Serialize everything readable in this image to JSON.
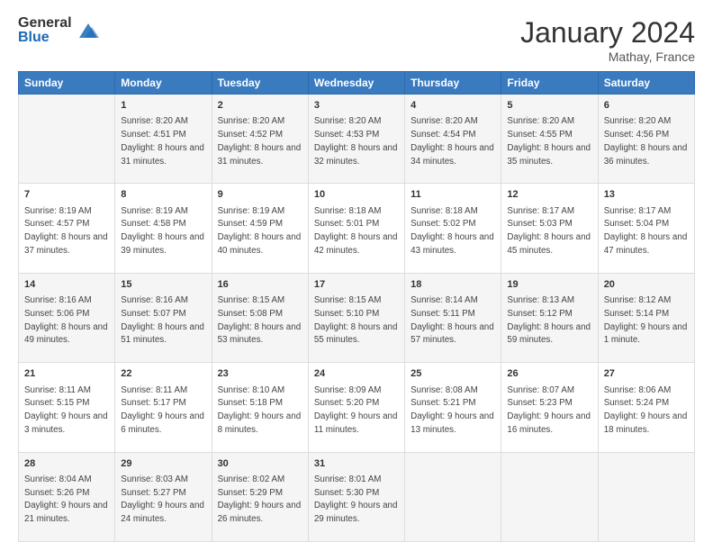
{
  "logo": {
    "general": "General",
    "blue": "Blue"
  },
  "title": "January 2024",
  "location": "Mathay, France",
  "days_of_week": [
    "Sunday",
    "Monday",
    "Tuesday",
    "Wednesday",
    "Thursday",
    "Friday",
    "Saturday"
  ],
  "weeks": [
    [
      {
        "num": "",
        "sunrise": "",
        "sunset": "",
        "daylight": ""
      },
      {
        "num": "1",
        "sunrise": "Sunrise: 8:20 AM",
        "sunset": "Sunset: 4:51 PM",
        "daylight": "Daylight: 8 hours and 31 minutes."
      },
      {
        "num": "2",
        "sunrise": "Sunrise: 8:20 AM",
        "sunset": "Sunset: 4:52 PM",
        "daylight": "Daylight: 8 hours and 31 minutes."
      },
      {
        "num": "3",
        "sunrise": "Sunrise: 8:20 AM",
        "sunset": "Sunset: 4:53 PM",
        "daylight": "Daylight: 8 hours and 32 minutes."
      },
      {
        "num": "4",
        "sunrise": "Sunrise: 8:20 AM",
        "sunset": "Sunset: 4:54 PM",
        "daylight": "Daylight: 8 hours and 34 minutes."
      },
      {
        "num": "5",
        "sunrise": "Sunrise: 8:20 AM",
        "sunset": "Sunset: 4:55 PM",
        "daylight": "Daylight: 8 hours and 35 minutes."
      },
      {
        "num": "6",
        "sunrise": "Sunrise: 8:20 AM",
        "sunset": "Sunset: 4:56 PM",
        "daylight": "Daylight: 8 hours and 36 minutes."
      }
    ],
    [
      {
        "num": "7",
        "sunrise": "Sunrise: 8:19 AM",
        "sunset": "Sunset: 4:57 PM",
        "daylight": "Daylight: 8 hours and 37 minutes."
      },
      {
        "num": "8",
        "sunrise": "Sunrise: 8:19 AM",
        "sunset": "Sunset: 4:58 PM",
        "daylight": "Daylight: 8 hours and 39 minutes."
      },
      {
        "num": "9",
        "sunrise": "Sunrise: 8:19 AM",
        "sunset": "Sunset: 4:59 PM",
        "daylight": "Daylight: 8 hours and 40 minutes."
      },
      {
        "num": "10",
        "sunrise": "Sunrise: 8:18 AM",
        "sunset": "Sunset: 5:01 PM",
        "daylight": "Daylight: 8 hours and 42 minutes."
      },
      {
        "num": "11",
        "sunrise": "Sunrise: 8:18 AM",
        "sunset": "Sunset: 5:02 PM",
        "daylight": "Daylight: 8 hours and 43 minutes."
      },
      {
        "num": "12",
        "sunrise": "Sunrise: 8:17 AM",
        "sunset": "Sunset: 5:03 PM",
        "daylight": "Daylight: 8 hours and 45 minutes."
      },
      {
        "num": "13",
        "sunrise": "Sunrise: 8:17 AM",
        "sunset": "Sunset: 5:04 PM",
        "daylight": "Daylight: 8 hours and 47 minutes."
      }
    ],
    [
      {
        "num": "14",
        "sunrise": "Sunrise: 8:16 AM",
        "sunset": "Sunset: 5:06 PM",
        "daylight": "Daylight: 8 hours and 49 minutes."
      },
      {
        "num": "15",
        "sunrise": "Sunrise: 8:16 AM",
        "sunset": "Sunset: 5:07 PM",
        "daylight": "Daylight: 8 hours and 51 minutes."
      },
      {
        "num": "16",
        "sunrise": "Sunrise: 8:15 AM",
        "sunset": "Sunset: 5:08 PM",
        "daylight": "Daylight: 8 hours and 53 minutes."
      },
      {
        "num": "17",
        "sunrise": "Sunrise: 8:15 AM",
        "sunset": "Sunset: 5:10 PM",
        "daylight": "Daylight: 8 hours and 55 minutes."
      },
      {
        "num": "18",
        "sunrise": "Sunrise: 8:14 AM",
        "sunset": "Sunset: 5:11 PM",
        "daylight": "Daylight: 8 hours and 57 minutes."
      },
      {
        "num": "19",
        "sunrise": "Sunrise: 8:13 AM",
        "sunset": "Sunset: 5:12 PM",
        "daylight": "Daylight: 8 hours and 59 minutes."
      },
      {
        "num": "20",
        "sunrise": "Sunrise: 8:12 AM",
        "sunset": "Sunset: 5:14 PM",
        "daylight": "Daylight: 9 hours and 1 minute."
      }
    ],
    [
      {
        "num": "21",
        "sunrise": "Sunrise: 8:11 AM",
        "sunset": "Sunset: 5:15 PM",
        "daylight": "Daylight: 9 hours and 3 minutes."
      },
      {
        "num": "22",
        "sunrise": "Sunrise: 8:11 AM",
        "sunset": "Sunset: 5:17 PM",
        "daylight": "Daylight: 9 hours and 6 minutes."
      },
      {
        "num": "23",
        "sunrise": "Sunrise: 8:10 AM",
        "sunset": "Sunset: 5:18 PM",
        "daylight": "Daylight: 9 hours and 8 minutes."
      },
      {
        "num": "24",
        "sunrise": "Sunrise: 8:09 AM",
        "sunset": "Sunset: 5:20 PM",
        "daylight": "Daylight: 9 hours and 11 minutes."
      },
      {
        "num": "25",
        "sunrise": "Sunrise: 8:08 AM",
        "sunset": "Sunset: 5:21 PM",
        "daylight": "Daylight: 9 hours and 13 minutes."
      },
      {
        "num": "26",
        "sunrise": "Sunrise: 8:07 AM",
        "sunset": "Sunset: 5:23 PM",
        "daylight": "Daylight: 9 hours and 16 minutes."
      },
      {
        "num": "27",
        "sunrise": "Sunrise: 8:06 AM",
        "sunset": "Sunset: 5:24 PM",
        "daylight": "Daylight: 9 hours and 18 minutes."
      }
    ],
    [
      {
        "num": "28",
        "sunrise": "Sunrise: 8:04 AM",
        "sunset": "Sunset: 5:26 PM",
        "daylight": "Daylight: 9 hours and 21 minutes."
      },
      {
        "num": "29",
        "sunrise": "Sunrise: 8:03 AM",
        "sunset": "Sunset: 5:27 PM",
        "daylight": "Daylight: 9 hours and 24 minutes."
      },
      {
        "num": "30",
        "sunrise": "Sunrise: 8:02 AM",
        "sunset": "Sunset: 5:29 PM",
        "daylight": "Daylight: 9 hours and 26 minutes."
      },
      {
        "num": "31",
        "sunrise": "Sunrise: 8:01 AM",
        "sunset": "Sunset: 5:30 PM",
        "daylight": "Daylight: 9 hours and 29 minutes."
      },
      {
        "num": "",
        "sunrise": "",
        "sunset": "",
        "daylight": ""
      },
      {
        "num": "",
        "sunrise": "",
        "sunset": "",
        "daylight": ""
      },
      {
        "num": "",
        "sunrise": "",
        "sunset": "",
        "daylight": ""
      }
    ]
  ]
}
